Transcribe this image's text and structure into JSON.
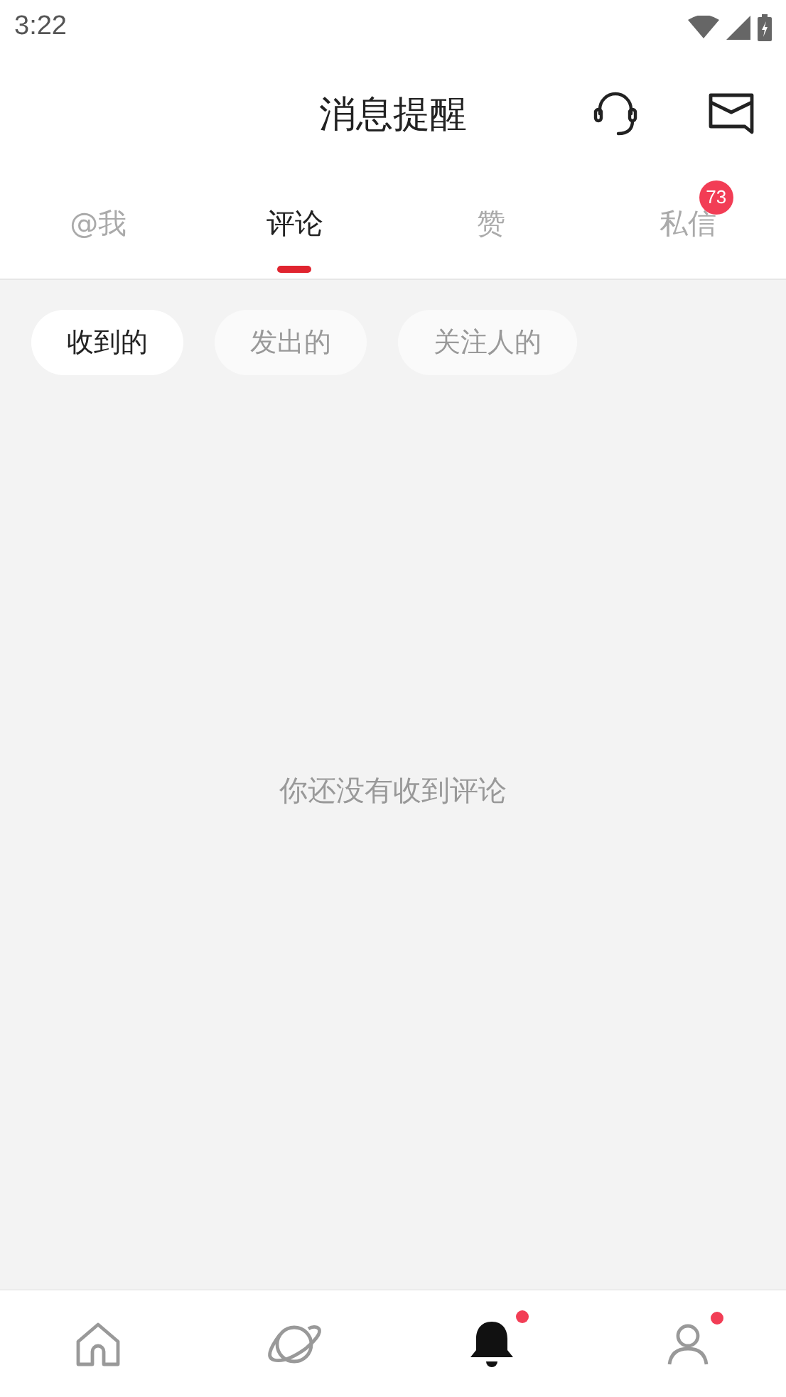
{
  "status_bar": {
    "time": "3:22"
  },
  "header": {
    "title": "消息提醒"
  },
  "tabs": [
    {
      "label": "@我",
      "selected": false
    },
    {
      "label": "评论",
      "selected": true
    },
    {
      "label": "赞",
      "selected": false
    },
    {
      "label": "私信",
      "selected": false,
      "badge": "73"
    }
  ],
  "filters": [
    {
      "label": "收到的",
      "selected": true
    },
    {
      "label": "发出的",
      "selected": false
    },
    {
      "label": "关注人的",
      "selected": false
    }
  ],
  "empty_message": "你还没有收到评论",
  "bottom_nav": [
    {
      "kind": "home",
      "selected": false,
      "dot": false
    },
    {
      "kind": "planet",
      "selected": false,
      "dot": false
    },
    {
      "kind": "bell",
      "selected": true,
      "dot": true
    },
    {
      "kind": "profile",
      "selected": false,
      "dot": true
    }
  ]
}
